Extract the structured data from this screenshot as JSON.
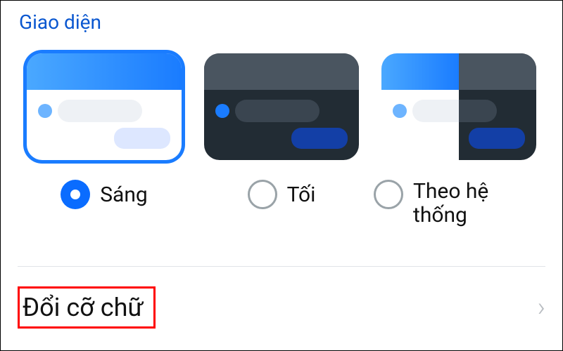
{
  "section": {
    "title": "Giao diện"
  },
  "themes": {
    "light": {
      "label": "Sáng",
      "selected": true
    },
    "dark": {
      "label": "Tối",
      "selected": false
    },
    "system": {
      "label": "Theo hệ thống",
      "selected": false
    }
  },
  "font_size_row": {
    "label": "Đổi cỡ chữ"
  },
  "colors": {
    "accent": "#0a6cff",
    "title": "#0a57d0",
    "highlight_box": "#ff0000"
  }
}
